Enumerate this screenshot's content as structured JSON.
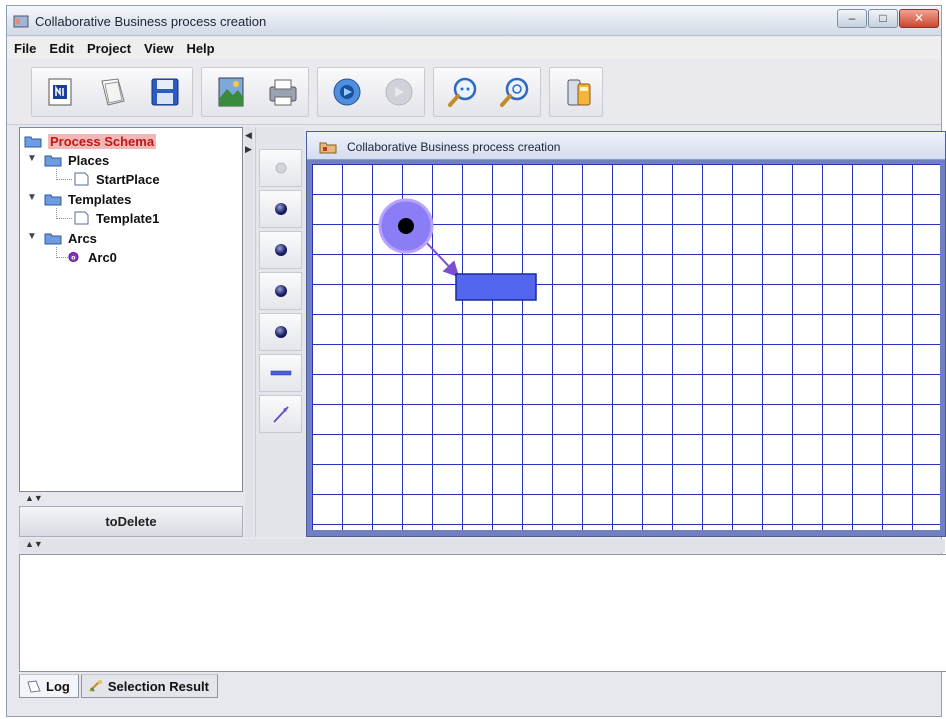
{
  "window": {
    "title": "Collaborative Business process creation",
    "controls": [
      "minimize",
      "maximize",
      "close"
    ]
  },
  "menu": [
    "File",
    "Edit",
    "Project",
    "View",
    "Help"
  ],
  "toolbar": {
    "groups": [
      [
        "new-icon",
        "open-icon",
        "save-icon"
      ],
      [
        "image-icon",
        "print-icon"
      ],
      [
        "run-icon",
        "stop-icon"
      ],
      [
        "zoom-out-icon",
        "zoom-in-icon"
      ],
      [
        "settings-icon"
      ]
    ]
  },
  "tree": {
    "root": "Process Schema",
    "places": {
      "label": "Places",
      "children": [
        "StartPlace"
      ]
    },
    "templates": {
      "label": "Templates",
      "children": [
        "Template1"
      ]
    },
    "arcs": {
      "label": "Arcs",
      "children": [
        "Arc0"
      ]
    }
  },
  "todelete_label": "toDelete",
  "palette": [
    "token-place-icon",
    "place-icon",
    "place-icon",
    "place-icon",
    "place-icon",
    "transition-icon",
    "arc-icon"
  ],
  "canvas": {
    "title": "Collaborative Business process creation",
    "colors": {
      "grid": "#2733b8",
      "place": "#8b7df5",
      "transition": "#5566ee",
      "arc": "#7a4fd0"
    }
  },
  "tabs": [
    {
      "label": "Log",
      "icon": "log-icon"
    },
    {
      "label": "Selection Result",
      "icon": "selection-icon"
    }
  ]
}
